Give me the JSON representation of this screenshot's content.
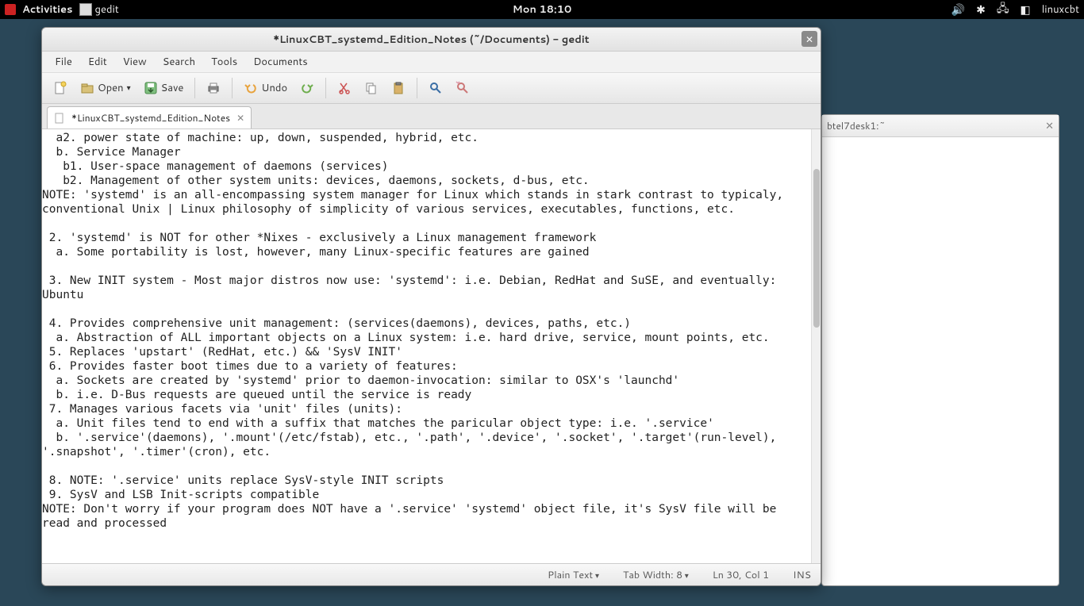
{
  "topbar": {
    "activities": "Activities",
    "app": "gedit",
    "clock": "Mon 18:10",
    "user": "linuxcbt"
  },
  "terminal": {
    "title": "btel7desk1:~"
  },
  "gedit": {
    "title": "*LinuxCBT_systemd_Edition_Notes (~/Documents) - gedit",
    "menu": {
      "file": "File",
      "edit": "Edit",
      "view": "View",
      "search": "Search",
      "tools": "Tools",
      "documents": "Documents"
    },
    "toolbar": {
      "open": "Open",
      "save": "Save",
      "undo": "Undo"
    },
    "tab": {
      "name": "*LinuxCBT_systemd_Edition_Notes"
    },
    "text": "  a2. power state of machine: up, down, suspended, hybrid, etc.\n  b. Service Manager\n   b1. User-space management of daemons (services)\n   b2. Management of other system units: devices, daemons, sockets, d-bus, etc.\nNOTE: 'systemd' is an all-encompassing system manager for Linux which stands in stark contrast to typicaly, conventional Unix | Linux philosophy of simplicity of various services, executables, functions, etc.\n\n 2. 'systemd' is NOT for other *Nixes - exclusively a Linux management framework\n  a. Some portability is lost, however, many Linux-specific features are gained\n\n 3. New INIT system - Most major distros now use: 'systemd': i.e. Debian, RedHat and SuSE, and eventually: Ubuntu\n\n 4. Provides comprehensive unit management: (services(daemons), devices, paths, etc.)\n  a. Abstraction of ALL important objects on a Linux system: i.e. hard drive, service, mount points, etc.\n 5. Replaces 'upstart' (RedHat, etc.) && 'SysV INIT'\n 6. Provides faster boot times due to a variety of features:\n  a. Sockets are created by 'systemd' prior to daemon-invocation: similar to OSX's 'launchd'\n  b. i.e. D-Bus requests are queued until the service is ready\n 7. Manages various facets via 'unit' files (units):\n  a. Unit files tend to end with a suffix that matches the paricular object type: i.e. '.service'\n  b. '.service'(daemons), '.mount'(/etc/fstab), etc., '.path', '.device', '.socket', '.target'(run-level), '.snapshot', '.timer'(cron), etc.\n\n 8. NOTE: '.service' units replace SysV-style INIT scripts\n 9. SysV and LSB Init-scripts compatible\nNOTE: Don't worry if your program does NOT have a '.service' 'systemd' object file, it's SysV file will be read and processed\n",
    "status": {
      "syntax": "Plain Text",
      "tabwidth": "Tab Width: 8",
      "position": "Ln 30, Col 1",
      "mode": "INS"
    }
  }
}
